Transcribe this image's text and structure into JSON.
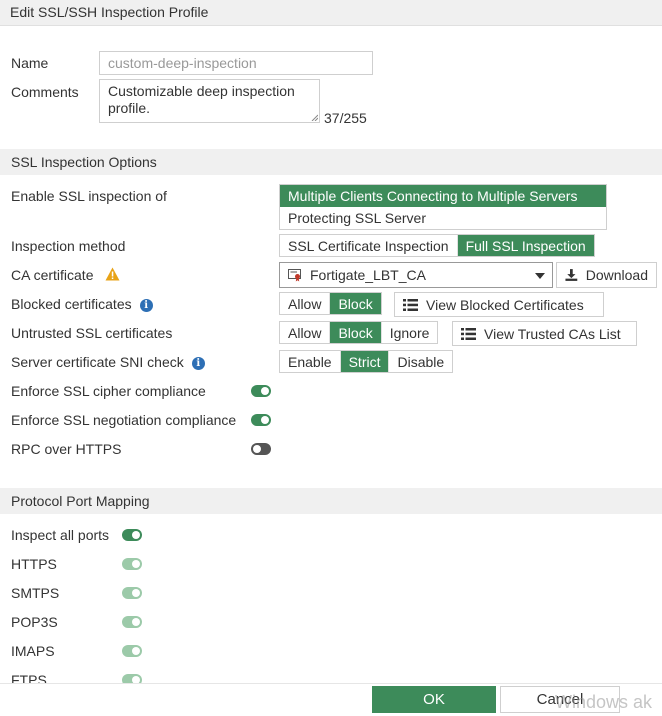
{
  "window": {
    "title": "Edit SSL/SSH Inspection Profile"
  },
  "name": {
    "label": "Name",
    "value": "custom-deep-inspection"
  },
  "comments": {
    "label": "Comments",
    "value": "Customizable deep inspection profile.",
    "counter": "37/255"
  },
  "ssl_section": {
    "title": "SSL Inspection Options",
    "enable_ssl": {
      "label": "Enable SSL inspection of",
      "options": [
        "Multiple Clients Connecting to Multiple Servers",
        "Protecting SSL Server"
      ],
      "selected": "Multiple Clients Connecting to Multiple Servers"
    },
    "inspection_method": {
      "label": "Inspection method",
      "options": [
        "SSL Certificate Inspection",
        "Full SSL Inspection"
      ],
      "selected": "Full SSL Inspection"
    },
    "ca_certificate": {
      "label": "CA certificate",
      "value": "Fortigate_LBT_CA",
      "download_label": "Download",
      "warning_icon": "warning-triangle-icon"
    },
    "blocked_certs": {
      "label": "Blocked certificates",
      "options": [
        "Allow",
        "Block"
      ],
      "selected": "Block",
      "view_label": "View Blocked Certificates"
    },
    "untrusted_certs": {
      "label": "Untrusted SSL certificates",
      "options": [
        "Allow",
        "Block",
        "Ignore"
      ],
      "selected": "Block",
      "view_label": "View Trusted CAs List"
    },
    "sni_check": {
      "label": "Server certificate SNI check",
      "options": [
        "Enable",
        "Strict",
        "Disable"
      ],
      "selected": "Strict"
    },
    "cipher_compliance": {
      "label": "Enforce SSL cipher compliance",
      "enabled": true
    },
    "negotiation_compliance": {
      "label": "Enforce SSL negotiation compliance",
      "enabled": true
    },
    "rpc_https": {
      "label": "RPC over HTTPS",
      "enabled": false
    }
  },
  "port_section": {
    "title": "Protocol Port Mapping",
    "inspect_all": {
      "label": "Inspect all ports",
      "enabled": true
    },
    "protocols": [
      {
        "label": "HTTPS",
        "enabled": true
      },
      {
        "label": "SMTPS",
        "enabled": true
      },
      {
        "label": "POP3S",
        "enabled": true
      },
      {
        "label": "IMAPS",
        "enabled": true
      },
      {
        "label": "FTPS",
        "enabled": true
      }
    ]
  },
  "footer": {
    "ok_label": "OK",
    "cancel_label": "Cancel",
    "watermark": "Windows ak"
  },
  "colors": {
    "accent": "#3d8b5a",
    "section_bg": "#f0f0f0",
    "info": "#2d6fb5",
    "warning": "#e8a317"
  }
}
